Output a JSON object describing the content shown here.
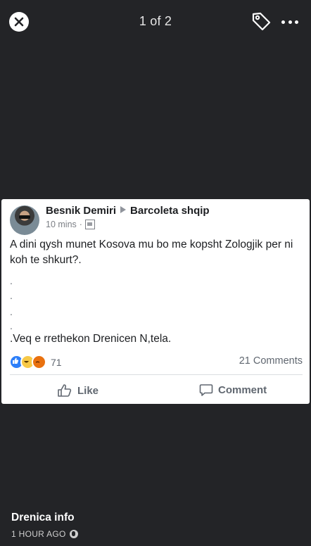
{
  "viewer": {
    "counter": "1 of 2",
    "close_icon": "close-icon",
    "tag_icon": "tag-icon",
    "more_icon": "more-horizontal-icon"
  },
  "post": {
    "author": "Besnik Demiri",
    "group": "Barcoleta shqip",
    "time": "10 mins",
    "audience_icon": "group-audience-icon",
    "text_main": "A dini qysh munet Kosova mu bo me kopsht Zologjik per ni koh te shkurt?.",
    "dots": [
      ".",
      ".",
      ".",
      "."
    ],
    "text_end": ".Veq e rrethekon Drenicen N,tela.",
    "reactions": {
      "types": [
        "like",
        "haha",
        "angry"
      ],
      "count": "71"
    },
    "comments_count": "21 Comments",
    "like_label": "Like",
    "comment_label": "Comment"
  },
  "footer": {
    "page_name": "Drenica info",
    "timestamp": "1 HOUR AGO",
    "globe_icon": "globe-icon"
  },
  "colors": {
    "background": "#232427",
    "like": "#2d7ff9",
    "haha": "#f7c948",
    "angry": "#e9710f"
  }
}
